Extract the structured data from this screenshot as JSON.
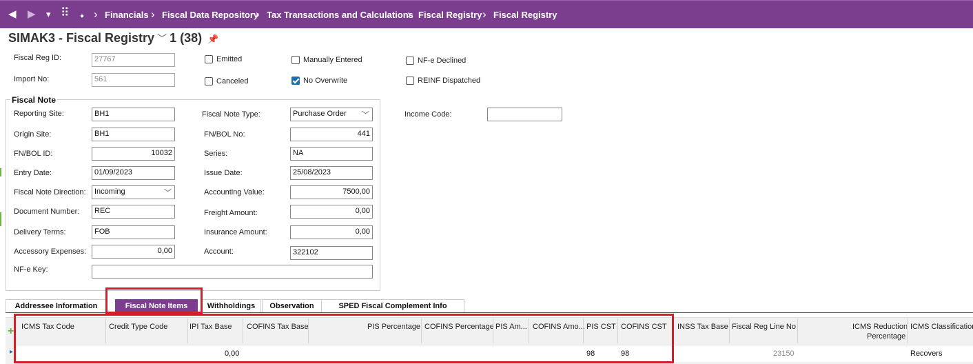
{
  "nav": {
    "back": "◀",
    "forward": "▶",
    "menu": "▾",
    "apps": "⠿",
    "dot": "●",
    "sep": "›",
    "breadcrumbs": [
      "Financials",
      "Fiscal Data Repository",
      "Tax Transactions and Calculations",
      "Fiscal Registry",
      "Fiscal Registry"
    ]
  },
  "header": {
    "title": "SIMAK3 - Fiscal Registry",
    "chevron": "﹀",
    "record_count": "1 (38)",
    "pin": "📌"
  },
  "top_fields": {
    "fiscal_reg_id_label": "Fiscal Reg ID:",
    "fiscal_reg_id_value": "27767",
    "import_no_label": "Import No:",
    "import_no_value": "561"
  },
  "checkboxes": {
    "emitted": {
      "label": "Emitted",
      "checked": false
    },
    "canceled": {
      "label": "Canceled",
      "checked": false
    },
    "manually_entered": {
      "label": "Manually Entered",
      "checked": false
    },
    "no_overwrite": {
      "label": "No Overwrite",
      "checked": true
    },
    "nfe_declined": {
      "label": "NF-e Declined",
      "checked": false
    },
    "reinf_dispatched": {
      "label": "REINF Dispatched",
      "checked": false
    }
  },
  "fiscal_note": {
    "title": "Fiscal Note",
    "reporting_site_label": "Reporting Site:",
    "reporting_site": "BH1",
    "origin_site_label": "Origin Site:",
    "origin_site": "BH1",
    "fn_bol_id_label": "FN/BOL ID:",
    "fn_bol_id": "10032",
    "entry_date_label": "Entry Date:",
    "entry_date": "01/09/2023",
    "direction_label": "Fiscal Note Direction:",
    "direction": "Incoming",
    "document_number_label": "Document Number:",
    "document_number": "REC",
    "delivery_terms_label": "Delivery Terms:",
    "delivery_terms": "FOB",
    "accessory_expenses_label": "Accessory Expenses:",
    "accessory_expenses": "0,00",
    "nfe_key_label": "NF-e Key:",
    "nfe_key": "",
    "note_type_label": "Fiscal Note Type:",
    "note_type": "Purchase Order",
    "fn_bol_no_label": "FN/BOL No:",
    "fn_bol_no": "441",
    "series_label": "Series:",
    "series": "NA",
    "issue_date_label": "Issue Date:",
    "issue_date": "25/08/2023",
    "accounting_value_label": "Accounting Value:",
    "accounting_value": "7500,00",
    "freight_amount_label": "Freight Amount:",
    "freight_amount": "0,00",
    "insurance_amount_label": "Insurance Amount:",
    "insurance_amount": "0,00",
    "account_label": "Account:",
    "account": "322102",
    "income_code_label": "Income Code:",
    "income_code": ""
  },
  "tabs": [
    "Addressee Information",
    "Fiscal Note Items",
    "Withholdings",
    "Observation",
    "SPED Fiscal Complement Info"
  ],
  "grid": {
    "add_icon": "+",
    "row_marker": "▸",
    "columns": [
      "ICMS Tax Code",
      "Credit Type Code",
      "IPI Tax Base",
      "COFINS Tax Base",
      "PIS Percentage",
      "COFINS Percentage",
      "PIS Am...",
      "COFINS Amo...",
      "PIS CST",
      "COFINS CST",
      "INSS Tax Base",
      "Fiscal Reg Line No",
      "ICMS Reduction",
      "Percentage",
      "ICMS Classification"
    ],
    "row": {
      "icms_tax_code": "",
      "credit_type_code": "",
      "ipi_tax_base": "0,00",
      "pis_cst": "98",
      "cofins_cst": "98",
      "fiscal_reg_line_no": "23150",
      "icms_classification": "Recovers"
    }
  },
  "colors": {
    "brand": "#7b3e8e",
    "highlight": "#d0202b",
    "checked": "#1a6fb0"
  }
}
